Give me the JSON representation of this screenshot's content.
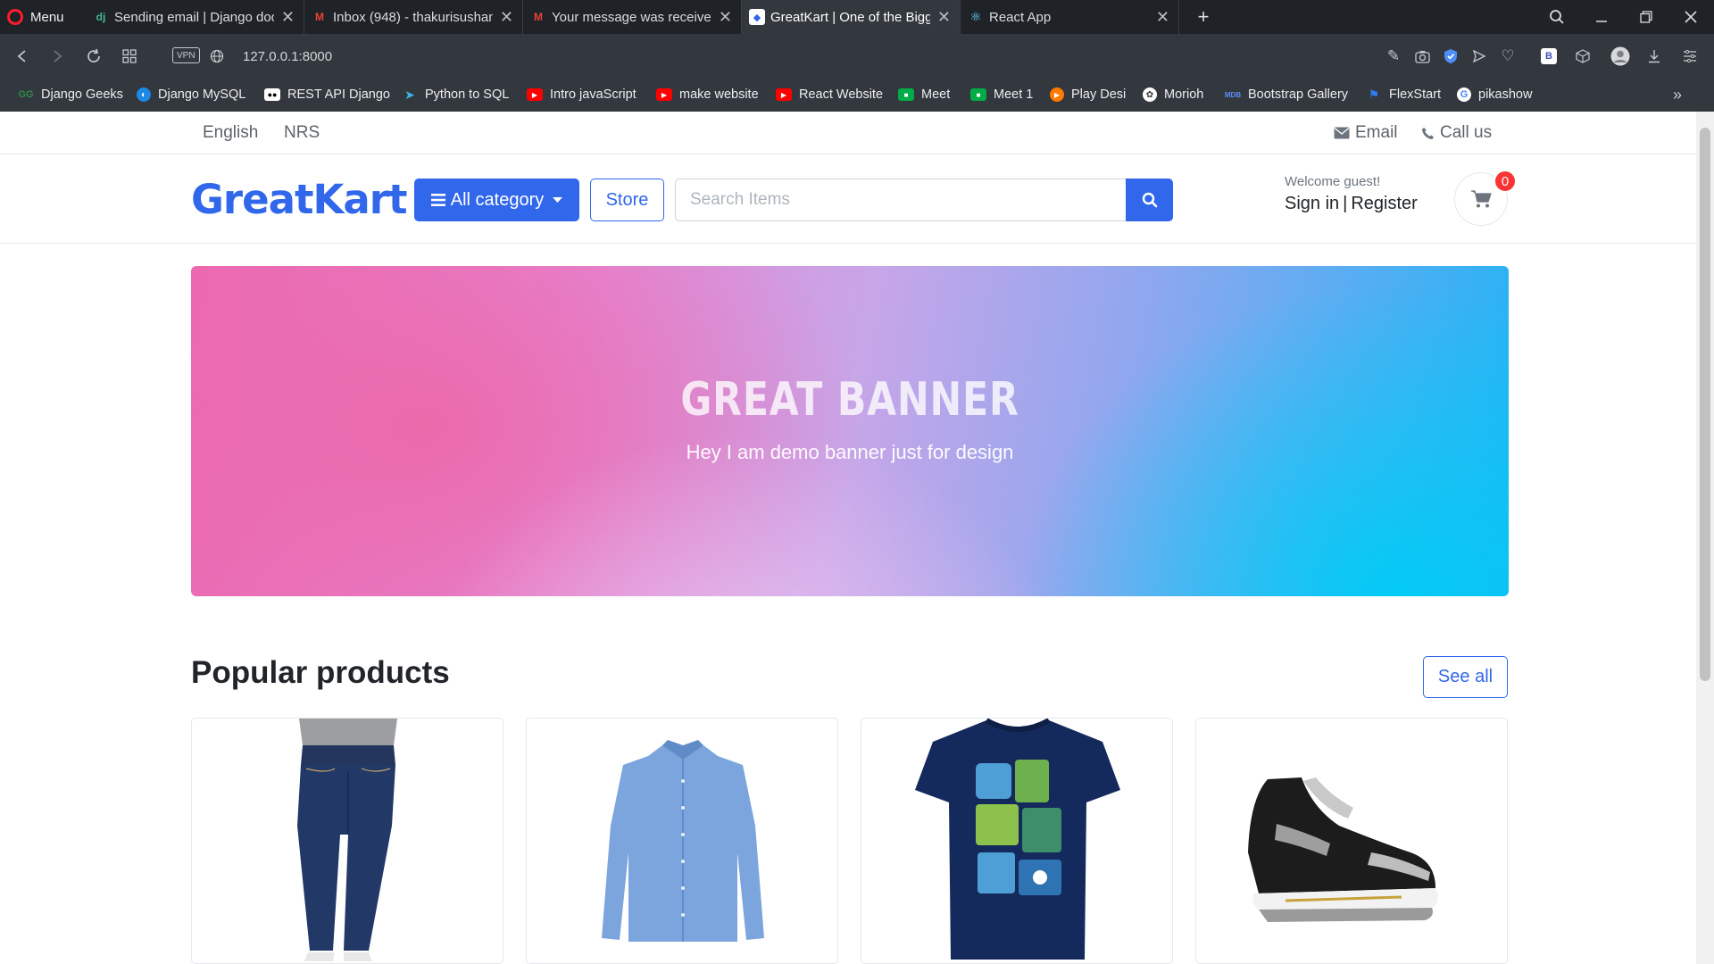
{
  "browser": {
    "menu_label": "Menu",
    "tabs": [
      {
        "title": "Sending email | Django doc",
        "favicon": "dj"
      },
      {
        "title": "Inbox (948) - thakurisushan",
        "favicon": "M"
      },
      {
        "title": "Your message was received",
        "favicon": "M"
      },
      {
        "title": "GreatKart | One of the Bigg",
        "favicon": "gk"
      },
      {
        "title": "React App",
        "favicon": "react"
      }
    ],
    "vpn_label": "VPN",
    "url": "127.0.0.1:8000",
    "bookmarks": [
      {
        "label": "Django Geeks",
        "icon": "gfg-icon"
      },
      {
        "label": "Django MySQL",
        "icon": "django-icon"
      },
      {
        "label": "REST API Django",
        "icon": "medium-icon"
      },
      {
        "label": "Python to SQL",
        "icon": "bird-icon"
      },
      {
        "label": "Intro javaScript",
        "icon": "youtube-icon"
      },
      {
        "label": "make website",
        "icon": "youtube-icon"
      },
      {
        "label": "React Website",
        "icon": "youtube-icon"
      },
      {
        "label": "Meet",
        "icon": "meet-icon"
      },
      {
        "label": "Meet 1",
        "icon": "meet-icon"
      },
      {
        "label": "Play Desi",
        "icon": "play-icon"
      },
      {
        "label": "Morioh",
        "icon": "morioh-icon"
      },
      {
        "label": "Bootstrap Gallery",
        "icon": "mdb-icon"
      },
      {
        "label": "FlexStart",
        "icon": "flexstart-icon"
      },
      {
        "label": "pikashow",
        "icon": "google-icon"
      }
    ]
  },
  "site": {
    "topbar": {
      "language": "English",
      "currency": "NRS",
      "email_label": "Email",
      "call_label": "Call us"
    },
    "header": {
      "logo": "GreatKart",
      "category_button": "All category",
      "store_button": "Store",
      "search_placeholder": "Search Items",
      "welcome": "Welcome guest!",
      "sign_in": "Sign in",
      "separator": "|",
      "register": "Register",
      "cart_count": "0"
    },
    "banner": {
      "title": "GREAT BANNER",
      "subtitle": "Hey I am demo banner just for design"
    },
    "products_section": {
      "title": "Popular products",
      "see_all": "See all",
      "products": [
        {
          "image": "jeans"
        },
        {
          "image": "blue-shirt"
        },
        {
          "image": "navy-tshirt"
        },
        {
          "image": "sneaker"
        }
      ]
    }
  },
  "colors": {
    "primary": "#3167eb",
    "badge": "#fa3434",
    "chrome_dark": "#1f2227",
    "chrome": "#33373e"
  }
}
